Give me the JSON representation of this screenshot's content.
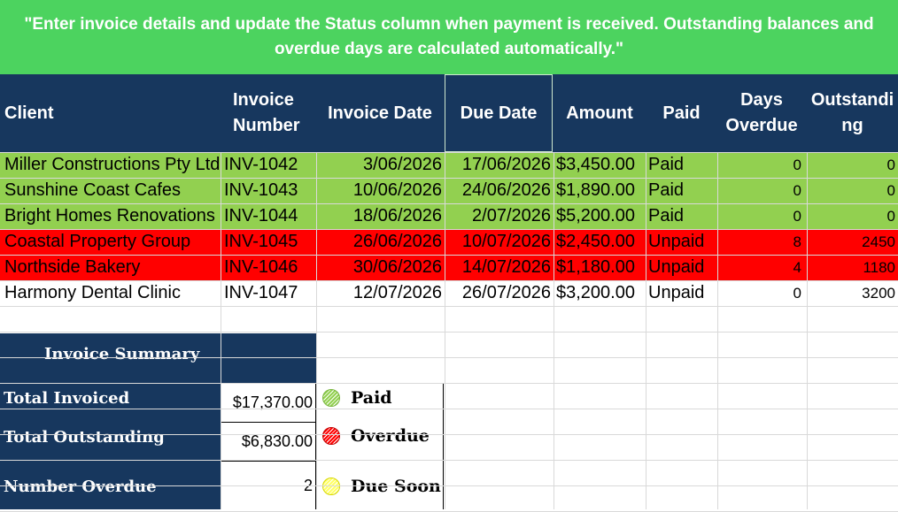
{
  "banner": {
    "text": "\"Enter invoice details and update the Status column when payment is received. Outstanding balances and overdue days are calculated automatically.\""
  },
  "columns": [
    {
      "label": "Client"
    },
    {
      "label": "Invoice Number"
    },
    {
      "label": "Invoice Date"
    },
    {
      "label": "Due Date"
    },
    {
      "label": "Amount"
    },
    {
      "label": "Paid"
    },
    {
      "label": "Days Overdue"
    },
    {
      "label": "Outstanding"
    }
  ],
  "rows": [
    {
      "client": "Miller Constructions Pty Ltd",
      "invoice": "INV-1042",
      "invoice_date": "3/06/2026",
      "due_date": "17/06/2026",
      "amount": "$3,450.00",
      "paid": "Paid",
      "days_overdue": "0",
      "outstanding": "0",
      "status_color": "#92d050"
    },
    {
      "client": "Sunshine Coast Cafes",
      "invoice": "INV-1043",
      "invoice_date": "10/06/2026",
      "due_date": "24/06/2026",
      "amount": "$1,890.00",
      "paid": "Paid",
      "days_overdue": "0",
      "outstanding": "0",
      "status_color": "#92d050"
    },
    {
      "client": "Bright Homes Renovations",
      "invoice": "INV-1044",
      "invoice_date": "18/06/2026",
      "due_date": "2/07/2026",
      "amount": "$5,200.00",
      "paid": "Paid",
      "days_overdue": "0",
      "outstanding": "0",
      "status_color": "#92d050"
    },
    {
      "client": "Coastal Property Group",
      "invoice": "INV-1045",
      "invoice_date": "26/06/2026",
      "due_date": "10/07/2026",
      "amount": "$2,450.00",
      "paid": "Unpaid",
      "days_overdue": "8",
      "outstanding": "2450",
      "status_color": "#ff0000"
    },
    {
      "client": "Northside Bakery",
      "invoice": "INV-1046",
      "invoice_date": "30/06/2026",
      "due_date": "14/07/2026",
      "amount": "$1,180.00",
      "paid": "Unpaid",
      "days_overdue": "4",
      "outstanding": "1180",
      "status_color": "#ff0000"
    },
    {
      "client": "Harmony Dental Clinic",
      "invoice": "INV-1047",
      "invoice_date": "12/07/2026",
      "due_date": "26/07/2026",
      "amount": "$3,200.00",
      "paid": "Unpaid",
      "days_overdue": "0",
      "outstanding": "3200",
      "status_color": "#ffffff"
    }
  ],
  "summary": {
    "title": "Invoice Summary",
    "items": [
      {
        "label": "Total Invoiced",
        "value": "$17,370.00"
      },
      {
        "label": "Total Outstanding",
        "value": "$6,830.00"
      },
      {
        "label": "Number Overdue",
        "value": "2"
      }
    ]
  },
  "legend": [
    {
      "label": "Paid",
      "color": "#92d050",
      "border": "#7ab640"
    },
    {
      "label": "Overdue",
      "color": "#ff0000",
      "border": "#c00000"
    },
    {
      "label": "Due Soon",
      "color": "#ffff66",
      "border": "#d6d600"
    }
  ],
  "colors": {
    "banner": "#4cd35f",
    "header": "#17375e",
    "paid_row": "#92d050",
    "overdue_row": "#ff0000"
  }
}
